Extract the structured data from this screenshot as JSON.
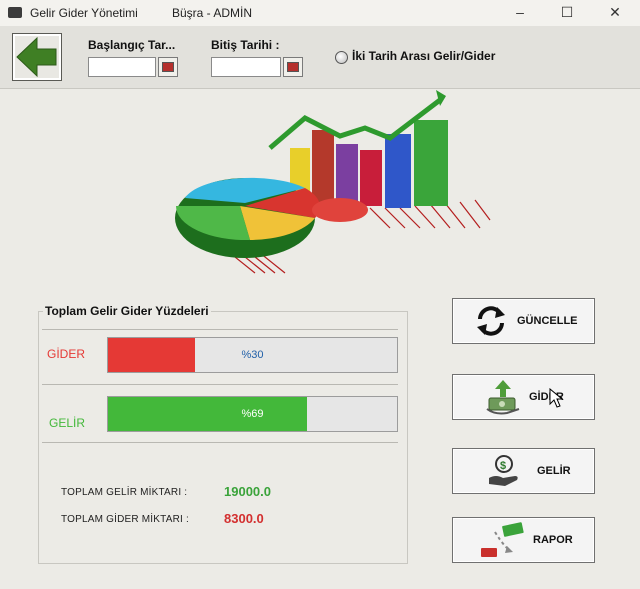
{
  "window": {
    "title": "Gelir Gider Yönetimi",
    "user": "Büşra - ADMİN",
    "minimize": "–",
    "maximize": "☐",
    "close": "✕"
  },
  "toolbar": {
    "start_date_label": "Başlangıç Tar...",
    "start_date_value": "",
    "end_date_label": "Bitiş Tarihi :",
    "end_date_value": "",
    "range_option_label": "İki Tarih Arası Gelir/Gider"
  },
  "summary": {
    "group_title": "Toplam Gelir Gider Yüzdeleri",
    "expense_label": "GİDER",
    "expense_percent_text": "%30",
    "expense_fraction": 0.3,
    "income_label": "GELİR",
    "income_percent_text": "%69",
    "income_fraction": 0.69,
    "total_income_label": "TOPLAM GELİR MİKTARI  :",
    "total_income_value": "19000.0",
    "total_expense_label": "TOPLAM GİDER MİKTARI  :",
    "total_expense_value": "8300.0"
  },
  "buttons": {
    "refresh": "GÜNCELLE",
    "expense": "GİDER",
    "income": "GELİR",
    "report": "RAPOR"
  },
  "colors": {
    "expense": "#e53935",
    "income": "#43b83a",
    "income_text": "#3aa33a",
    "expense_text": "#d32f2f",
    "percent_text": "#1f5fa8"
  }
}
